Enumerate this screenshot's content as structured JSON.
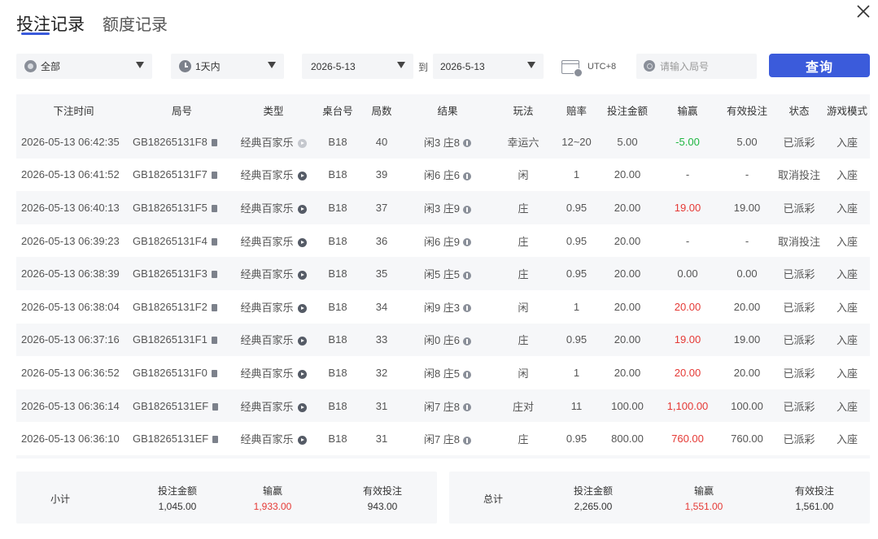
{
  "tabs": [
    {
      "label": "投注记录",
      "active": true
    },
    {
      "label": "额度记录",
      "active": false
    }
  ],
  "filters": {
    "game_type": "全部",
    "time_range": "1天内",
    "date_start": "2026-5-13",
    "to_label": "到",
    "date_end": "2026-5-13",
    "timezone": "UTC+8",
    "search_placeholder": "请输入局号",
    "query_button": "查询"
  },
  "table": {
    "headers": [
      "下注时间",
      "局号",
      "类型",
      "桌台号",
      "局数",
      "结果",
      "玩法",
      "赔率",
      "投注金额",
      "输赢",
      "有效投注",
      "状态",
      "游戏模式"
    ],
    "rows": [
      {
        "time": "2026-05-13 06:42:35",
        "round": "GB18265131F8",
        "type": "经典百家乐",
        "play_dim": true,
        "table": "B18",
        "shoe": "40",
        "result": "闲3 庄8",
        "bet": "幸运六",
        "odds": "12~20",
        "amount": "5.00",
        "winloss": "-5.00",
        "wl_sign": "neg",
        "valid": "5.00",
        "status": "已派彩",
        "mode": "入座"
      },
      {
        "time": "2026-05-13 06:41:52",
        "round": "GB18265131F7",
        "type": "经典百家乐",
        "play_dim": false,
        "table": "B18",
        "shoe": "39",
        "result": "闲6 庄6",
        "bet": "闲",
        "odds": "1",
        "amount": "20.00",
        "winloss": "-",
        "wl_sign": "none",
        "valid": "-",
        "status": "取消投注",
        "mode": "入座"
      },
      {
        "time": "2026-05-13 06:40:13",
        "round": "GB18265131F5",
        "type": "经典百家乐",
        "play_dim": false,
        "table": "B18",
        "shoe": "37",
        "result": "闲3 庄9",
        "bet": "庄",
        "odds": "0.95",
        "amount": "20.00",
        "winloss": "19.00",
        "wl_sign": "pos",
        "valid": "19.00",
        "status": "已派彩",
        "mode": "入座"
      },
      {
        "time": "2026-05-13 06:39:23",
        "round": "GB18265131F4",
        "type": "经典百家乐",
        "play_dim": false,
        "table": "B18",
        "shoe": "36",
        "result": "闲6 庄9",
        "bet": "庄",
        "odds": "0.95",
        "amount": "20.00",
        "winloss": "-",
        "wl_sign": "none",
        "valid": "-",
        "status": "取消投注",
        "mode": "入座"
      },
      {
        "time": "2026-05-13 06:38:39",
        "round": "GB18265131F3",
        "type": "经典百家乐",
        "play_dim": false,
        "table": "B18",
        "shoe": "35",
        "result": "闲5 庄5",
        "bet": "庄",
        "odds": "0.95",
        "amount": "20.00",
        "winloss": "0.00",
        "wl_sign": "none",
        "valid": "0.00",
        "status": "已派彩",
        "mode": "入座"
      },
      {
        "time": "2026-05-13 06:38:04",
        "round": "GB18265131F2",
        "type": "经典百家乐",
        "play_dim": false,
        "table": "B18",
        "shoe": "34",
        "result": "闲9 庄3",
        "bet": "闲",
        "odds": "1",
        "amount": "20.00",
        "winloss": "20.00",
        "wl_sign": "pos",
        "valid": "20.00",
        "status": "已派彩",
        "mode": "入座"
      },
      {
        "time": "2026-05-13 06:37:16",
        "round": "GB18265131F1",
        "type": "经典百家乐",
        "play_dim": false,
        "table": "B18",
        "shoe": "33",
        "result": "闲0 庄6",
        "bet": "庄",
        "odds": "0.95",
        "amount": "20.00",
        "winloss": "19.00",
        "wl_sign": "pos",
        "valid": "19.00",
        "status": "已派彩",
        "mode": "入座"
      },
      {
        "time": "2026-05-13 06:36:52",
        "round": "GB18265131F0",
        "type": "经典百家乐",
        "play_dim": false,
        "table": "B18",
        "shoe": "32",
        "result": "闲8 庄5",
        "bet": "闲",
        "odds": "1",
        "amount": "20.00",
        "winloss": "20.00",
        "wl_sign": "pos",
        "valid": "20.00",
        "status": "已派彩",
        "mode": "入座"
      },
      {
        "time": "2026-05-13 06:36:14",
        "round": "GB18265131EF",
        "type": "经典百家乐",
        "play_dim": false,
        "table": "B18",
        "shoe": "31",
        "result": "闲7 庄8",
        "bet": "庄对",
        "odds": "11",
        "amount": "100.00",
        "winloss": "1,100.00",
        "wl_sign": "pos",
        "valid": "100.00",
        "status": "已派彩",
        "mode": "入座"
      },
      {
        "time": "2026-05-13 06:36:10",
        "round": "GB18265131EF",
        "type": "经典百家乐",
        "play_dim": false,
        "table": "B18",
        "shoe": "31",
        "result": "闲7 庄8",
        "bet": "庄",
        "odds": "0.95",
        "amount": "800.00",
        "winloss": "760.00",
        "wl_sign": "pos",
        "valid": "760.00",
        "status": "已派彩",
        "mode": "入座"
      }
    ]
  },
  "subtotal": {
    "label": "小计",
    "amount_label": "投注金额",
    "amount": "1,045.00",
    "winloss_label": "输赢",
    "winloss": "1,933.00",
    "valid_label": "有效投注",
    "valid": "943.00"
  },
  "total": {
    "label": "总计",
    "amount_label": "投注金额",
    "amount": "2,265.00",
    "winloss_label": "输赢",
    "winloss": "1,551.00",
    "valid_label": "有效投注",
    "valid": "1,561.00"
  },
  "colors": {
    "accent": "#3b5bdb",
    "win": "#e53935",
    "loss": "#1db640"
  }
}
